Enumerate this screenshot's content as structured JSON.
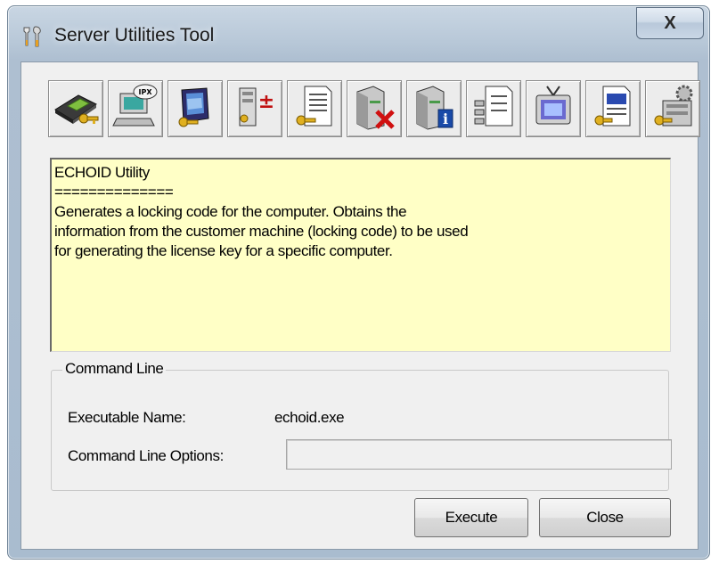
{
  "window": {
    "title": "Server Utilities Tool",
    "close_glyph": "X"
  },
  "toolbar": {
    "items": [
      {
        "name": "echoid-keypad-icon"
      },
      {
        "name": "ipx-computer-icon",
        "badge": "IPX"
      },
      {
        "name": "monitor-key-icon"
      },
      {
        "name": "server-plus-minus-icon"
      },
      {
        "name": "document-key-icon"
      },
      {
        "name": "server-delete-icon"
      },
      {
        "name": "server-info-icon"
      },
      {
        "name": "server-list-icon"
      },
      {
        "name": "tv-monitor-icon"
      },
      {
        "name": "document-window-icon"
      },
      {
        "name": "gears-key-icon"
      }
    ]
  },
  "description": {
    "lines": [
      "ECHOID Utility",
      "==============",
      "Generates a locking code for the computer. Obtains the",
      "information from the customer machine (locking code) to be used",
      "for generating the license key for a specific computer."
    ]
  },
  "command_line": {
    "legend": "Command Line",
    "executable_label": "Executable Name:",
    "executable_value": "echoid.exe",
    "options_label": "Command Line Options:",
    "options_value": ""
  },
  "buttons": {
    "execute": "Execute",
    "close": "Close"
  },
  "colors": {
    "description_bg": "#ffffc6",
    "dialog_bg": "#f0f0f0",
    "frame": "#b8c8d8"
  }
}
